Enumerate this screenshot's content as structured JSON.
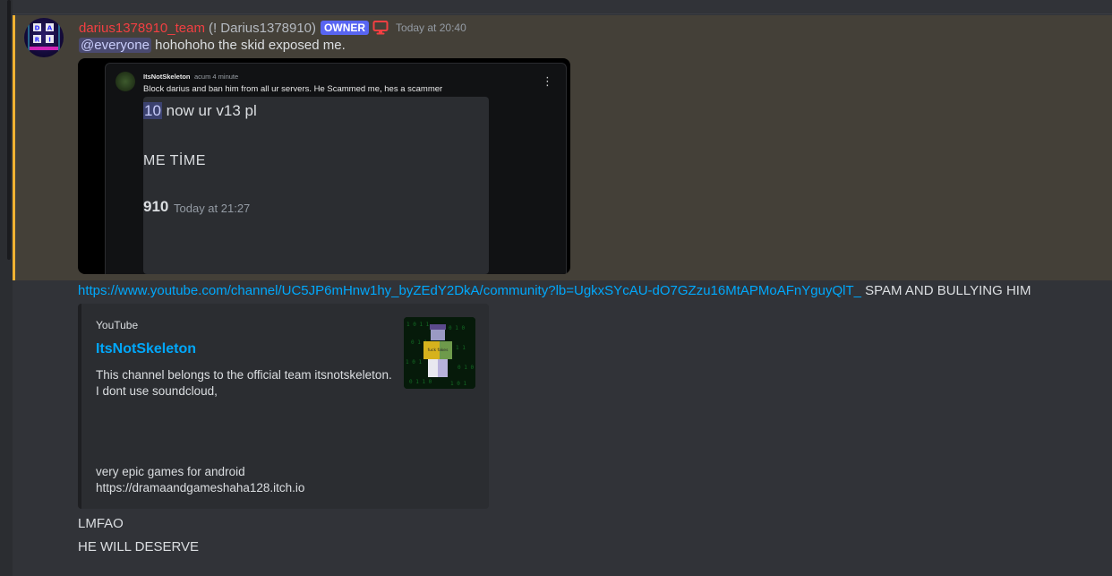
{
  "message": {
    "username": "darius1378910_team",
    "handle": "(! Darius1378910)",
    "role_badge": "OWNER",
    "role_icon": "monitor-icon",
    "timestamp": "Today at 20:40",
    "mention": "@everyone",
    "text": "hohohoho the skid exposed me.",
    "avatar_letters": [
      "D",
      "A",
      "R",
      "I"
    ],
    "colors": {
      "username": "#f23f42",
      "badge": "#5865f2",
      "mention_bar": "#f0b232"
    }
  },
  "attachment": {
    "user": "ItsNotSkeleton",
    "time": "acum 4 minute",
    "text": "Block darius and ban him from all ur servers. He Scammed me, hes a scammer",
    "line1_highlight": "10",
    "line1_rest": " now ur v13 pl",
    "line2": "ME TİME",
    "line3": "910",
    "line3_time": "Today at 21:27"
  },
  "link_message": {
    "url": "https://www.youtube.com/channel/UC5JP6mHnw1hy_byZEdY2DkA/community?lb=UgkxSYcAU-dO7GZzu16MtAPMoAFnYguyQlT_",
    "suffix": " SPAM AND BULLYING HIM"
  },
  "embed": {
    "provider": "YouTube",
    "title": "ItsNotSkeleton",
    "description": "This channel belongs to the official team itsnotskeleton.\nI dont use soundcloud,",
    "description2": "very epic games for android\nhttps://dramaandgameshaha128.itch.io",
    "thumb_text": "fuck fakes"
  },
  "followups": [
    "LMFAO",
    "HE WILL DESERVE"
  ]
}
